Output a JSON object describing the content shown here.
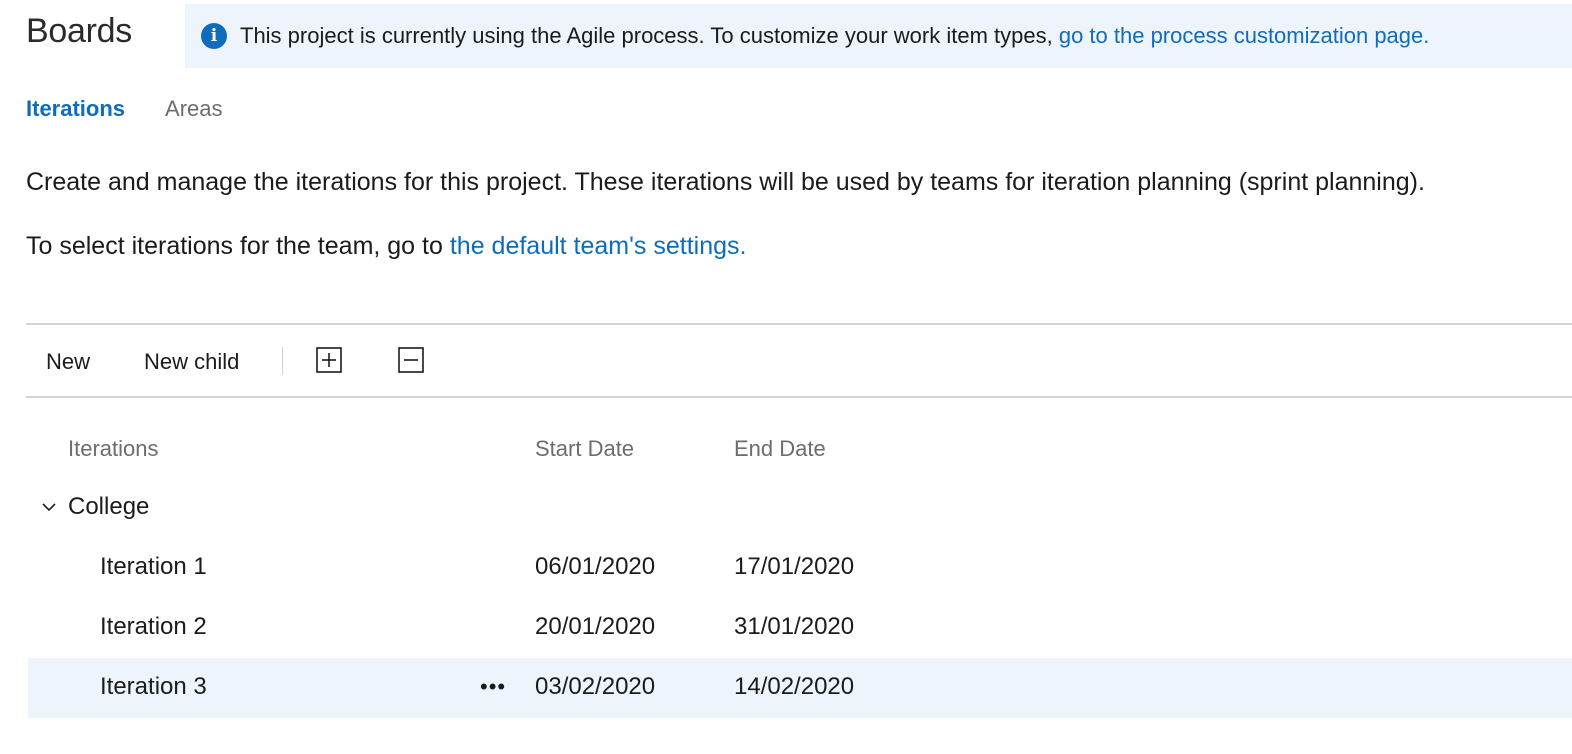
{
  "page_title": "Boards",
  "banner": {
    "icon": "info-icon",
    "text": "This project is currently using the Agile process. To customize your work item types,",
    "link": "go to the process customization page."
  },
  "tabs": [
    {
      "label": "Iterations",
      "active": true
    },
    {
      "label": "Areas",
      "active": false
    }
  ],
  "description": {
    "line1": "Create and manage the iterations for this project. These iterations will be used by teams for iteration planning (sprint planning).",
    "line2_prefix": "To select iterations for the team, go to",
    "line2_link": "the default team's settings."
  },
  "toolbar": {
    "new_label": "New",
    "new_child_label": "New child",
    "expand_icon": "expand-all-icon",
    "collapse_icon": "collapse-all-icon"
  },
  "grid": {
    "columns": [
      "Iterations",
      "Start Date",
      "End Date"
    ],
    "root": {
      "name": "College",
      "expanded": true
    },
    "rows": [
      {
        "name": "Iteration 1",
        "start": "06/01/2020",
        "end": "17/01/2020",
        "selected": false
      },
      {
        "name": "Iteration 2",
        "start": "20/01/2020",
        "end": "31/01/2020",
        "selected": false
      },
      {
        "name": "Iteration 3",
        "start": "03/02/2020",
        "end": "14/02/2020",
        "selected": true,
        "more_label": "•••"
      }
    ]
  },
  "colors": {
    "accent": "#0f6cbd",
    "banner_bg": "#eef4fb",
    "selected_row_bg": "#eef4fb",
    "muted_text": "#6d6d6d"
  }
}
